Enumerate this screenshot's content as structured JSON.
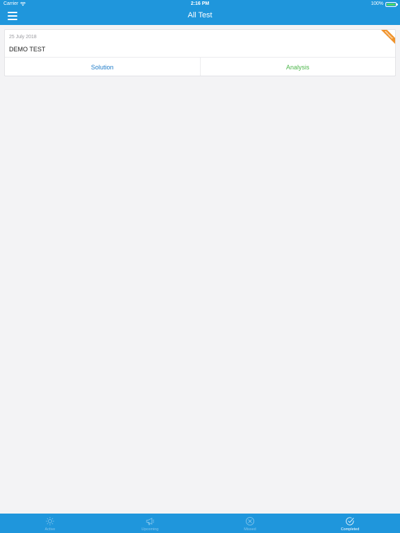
{
  "status_bar": {
    "carrier": "Carrier",
    "time": "2:16 PM",
    "battery_percent": "100%",
    "battery_level": 1.0
  },
  "nav": {
    "title": "All Test",
    "menu_icon": "hamburger-menu-icon"
  },
  "tests": [
    {
      "date": "25 July 2018",
      "title": "DEMO TEST",
      "ribbon": "Attempted",
      "actions": {
        "solution_label": "Solution",
        "analysis_label": "Analysis"
      }
    }
  ],
  "tabbar": {
    "items": [
      {
        "label": "Active",
        "icon": "sun-icon",
        "active": false
      },
      {
        "label": "Upcoming",
        "icon": "megaphone-icon",
        "active": false
      },
      {
        "label": "Missed",
        "icon": "x-circle-icon",
        "active": false
      },
      {
        "label": "Completed",
        "icon": "check-circle-icon",
        "active": true
      }
    ]
  },
  "colors": {
    "primary": "#1f96dc",
    "background": "#f3f3f5",
    "solution": "#1f7cc9",
    "analysis": "#4cb64a",
    "ribbon": "#f0932b"
  }
}
